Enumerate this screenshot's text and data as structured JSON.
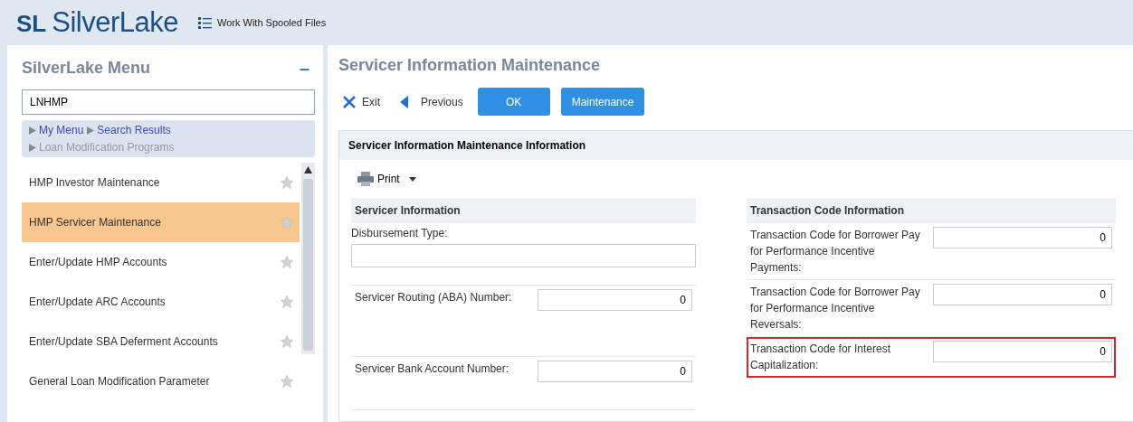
{
  "header": {
    "logo_mark": "SL",
    "logo_text": "SilverLake",
    "nav_link": "Work With Spooled Files"
  },
  "menu": {
    "title": "SilverLake Menu",
    "collapse": "–",
    "search_value": "LNHMP",
    "breadcrumb": [
      {
        "label": "My Menu",
        "kind": "link"
      },
      {
        "label": "Search Results",
        "kind": "link"
      },
      {
        "label": "Loan Modification Programs",
        "kind": "current"
      }
    ],
    "items": [
      {
        "label": "HMP Investor Maintenance",
        "selected": false
      },
      {
        "label": "HMP Servicer Maintenance",
        "selected": true
      },
      {
        "label": "Enter/Update HMP Accounts",
        "selected": false
      },
      {
        "label": "Enter/Update ARC Accounts",
        "selected": false
      },
      {
        "label": "Enter/Update SBA Deferment Accounts",
        "selected": false
      },
      {
        "label": "General Loan Modification Parameter",
        "selected": false
      }
    ]
  },
  "page": {
    "title": "Servicer Information Maintenance",
    "toolbar": [
      {
        "label": "Exit",
        "kind": "exit"
      },
      {
        "label": "Previous",
        "kind": "previous"
      },
      {
        "label": "OK",
        "kind": "primary"
      },
      {
        "label": "Maintenance",
        "kind": "primary"
      }
    ],
    "section_title": "Servicer Information Maintenance Information",
    "print": "Print",
    "servicer": {
      "title": "Servicer Information",
      "fields": [
        {
          "label": "Disbursement Type:",
          "kind": "stacked"
        },
        {
          "label": "Servicer Routing (ABA) Number:",
          "value": "0",
          "kind": "inline"
        },
        {
          "label": "Servicer Bank Account Number:",
          "value": "0",
          "kind": "inline"
        }
      ]
    },
    "transaction": {
      "title": "Transaction Code Information",
      "fields": [
        {
          "label": "Transaction Code for Borrower Pay for Performance Incentive Payments:",
          "value": "0",
          "highlighted": false
        },
        {
          "label": "Transaction Code for Borrower Pay for Performance Incentive Reversals:",
          "value": "0",
          "highlighted": false
        },
        {
          "label": "Transaction Code for Interest Capitalization:",
          "value": "0",
          "highlighted": true
        }
      ]
    }
  }
}
